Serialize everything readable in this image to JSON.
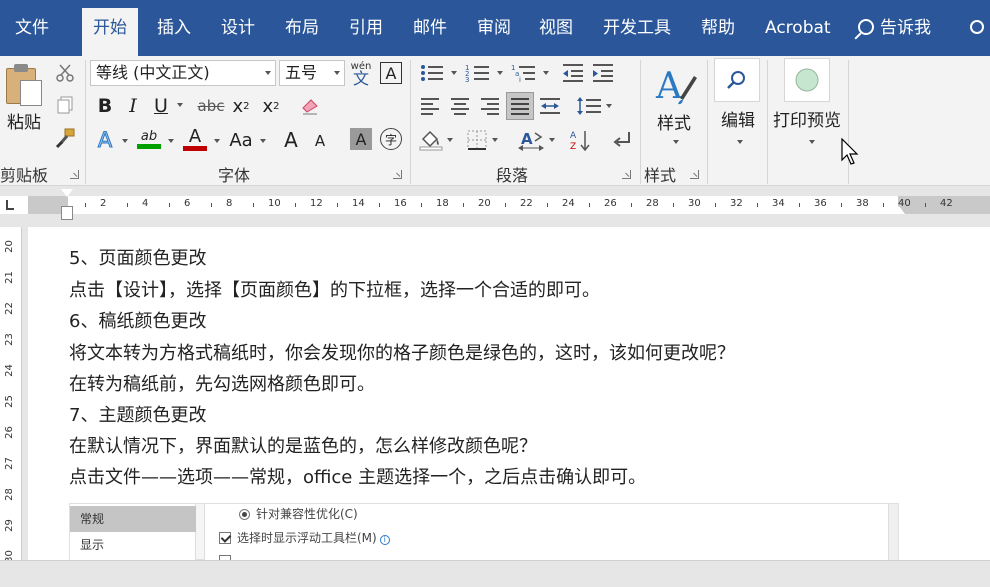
{
  "menu": {
    "tabs": [
      {
        "label": "文件"
      },
      {
        "label": "开始"
      },
      {
        "label": "插入"
      },
      {
        "label": "设计"
      },
      {
        "label": "布局"
      },
      {
        "label": "引用"
      },
      {
        "label": "邮件"
      },
      {
        "label": "审阅"
      },
      {
        "label": "视图"
      },
      {
        "label": "开发工具"
      },
      {
        "label": "帮助"
      },
      {
        "label": "Acrobat"
      }
    ],
    "search_label": "告诉我"
  },
  "ribbon": {
    "clipboard": {
      "paste": "粘贴",
      "label": "剪贴板"
    },
    "font": {
      "font_name": "等线 (中文正文)",
      "font_size": "五号",
      "wen_pinyin": "wén",
      "wen_char": "文",
      "border_char": "A",
      "bold": "B",
      "italic": "I",
      "underline": "U",
      "strike": "abc",
      "sub": "x",
      "sub_mark": "2",
      "sup": "x",
      "sup_mark": "2",
      "effects": "A",
      "highlight": "ab",
      "color": "A",
      "case": "Aa",
      "grow": "A",
      "shrink": "A",
      "shade": "A",
      "enclose": "字",
      "label": "字体"
    },
    "paragraph": {
      "label": "段落"
    },
    "styles": {
      "button": "样式",
      "label": "样式"
    },
    "editing": {
      "button": "编辑"
    },
    "print_preview": {
      "button": "打印预览"
    }
  },
  "ruler": {
    "numbers": [
      "2",
      "4",
      "6",
      "8",
      "10",
      "12",
      "14",
      "16",
      "18",
      "20",
      "22",
      "24",
      "26",
      "28",
      "30",
      "32",
      "34",
      "36",
      "38",
      "40",
      "42"
    ]
  },
  "vruler": {
    "numbers": [
      "20",
      "21",
      "22",
      "23",
      "24",
      "25",
      "26",
      "27",
      "28",
      "29",
      "30"
    ]
  },
  "document": {
    "lines": [
      "5、页面颜色更改",
      "点击【设计】，选择【页面颜色】的下拉框，选择一个合适的即可。",
      "6、稿纸颜色更改",
      "将文本转为方格式稿纸时，你会发现你的格子颜色是绿色的，这时，该如何更改呢？",
      "在转为稿纸前，先勾选网格颜色即可。",
      "7、主题颜色更改",
      "在默认情况下，界面默认的是蓝色的，怎么样修改颜色呢？",
      "点击文件——选项——常规，office 主题选择一个，之后点击确认即可。"
    ]
  },
  "options_dialog": {
    "nav": [
      {
        "label": "常规"
      },
      {
        "label": "显示"
      }
    ],
    "rows": [
      {
        "label": "针对兼容性优化(C)"
      },
      {
        "label": "选择时显示浮动工具栏(M)",
        "info": "i"
      }
    ]
  }
}
